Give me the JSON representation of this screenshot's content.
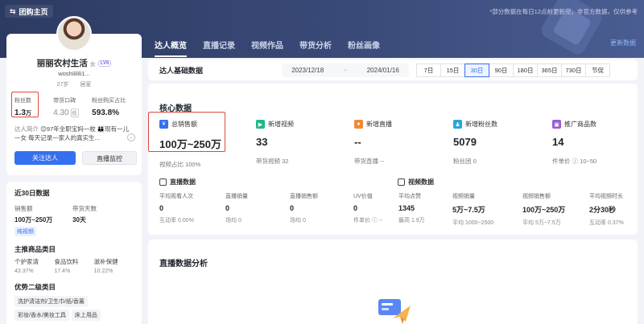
{
  "header": {
    "back_label": "团购主页",
    "note": "*部分数据在每日12点前更新完，非官方数据，仅供参考",
    "tabs": [
      {
        "label": "达人概览",
        "active": true
      },
      {
        "label": "直播记录",
        "active": false
      },
      {
        "label": "视频作品",
        "active": false
      },
      {
        "label": "带货分析",
        "active": false
      },
      {
        "label": "粉丝画像",
        "active": false
      }
    ],
    "right_link": "更新数据"
  },
  "profile": {
    "name": "丽丽农村生活",
    "level_tag": "LV6",
    "gender": "女",
    "handle": "woshililili1...",
    "age": "27岁",
    "location": "居家",
    "stats": [
      {
        "label": "粉丝数",
        "value": "1.3",
        "unit": "万"
      },
      {
        "label": "带货口碑",
        "value": "4.30",
        "badge": "低"
      },
      {
        "label": "粉丝购买占比",
        "value": "593.8%"
      }
    ],
    "bio_label": "达人简介",
    "bio_text": "😊97年全职宝妈一枚 👪现有一儿一女 每天记录一家人的真实生...",
    "follow_button": "关注达人",
    "live_button": "直播监控"
  },
  "left_panel": {
    "title": "近30日数据",
    "labels": [
      "销售额",
      "带货天数"
    ],
    "values": [
      "100万~250万",
      "30天"
    ],
    "chip": "纯视频",
    "category_title": "主推商品类目",
    "categories": [
      "个护家清",
      "食品饮料",
      "滋补保健"
    ],
    "category_pcts": [
      "43.37%",
      "17.4%",
      "10.22%"
    ],
    "secondary_title": "优势二级类目",
    "secondary_tags": [
      "洗护清洁剂/卫生巾/纸/香薰",
      "彩妆/香水/美妆工具",
      "床上用品"
    ]
  },
  "datebar": {
    "title": "达人基础数据",
    "start": "2023/12/18",
    "sep": "~",
    "end": "2024/01/16",
    "ranges": [
      {
        "label": "7日",
        "active": false
      },
      {
        "label": "15日",
        "active": false
      },
      {
        "label": "30日",
        "active": true
      },
      {
        "label": "90日",
        "active": false
      },
      {
        "label": "180日",
        "active": false
      },
      {
        "label": "365日",
        "active": false
      },
      {
        "label": "730日",
        "active": false
      },
      {
        "label": "节促",
        "active": false
      }
    ]
  },
  "core": {
    "title": "核心数据",
    "metrics": [
      {
        "label": "总销售额",
        "value": "100万~250万",
        "sub": "视频占比 100%",
        "color": "#3570f0"
      },
      {
        "label": "新增视频",
        "value": "33",
        "sub": "带货视频 32",
        "color": "#1fb88a"
      },
      {
        "label": "新增直播",
        "value": "--",
        "sub": "带货直播 --",
        "color": "#f08a34"
      },
      {
        "label": "新增粉丝数",
        "value": "5079",
        "sub": "粉丝团 0",
        "color": "#2aa6d8"
      },
      {
        "label": "推广商品数",
        "value": "14",
        "sub": "件单价 ⓘ 10~50",
        "color": "#9b59d6"
      }
    ],
    "live_data_title": "直播数据",
    "video_data_title": "视频数据",
    "live_metrics": [
      {
        "label": "平均观看人次",
        "value": "0",
        "sub": "互动率 0.00%"
      },
      {
        "label": "直播销量",
        "value": "0",
        "sub": "场均 0"
      },
      {
        "label": "直播销售额",
        "value": "0",
        "sub": "场均 0"
      },
      {
        "label": "UV价值",
        "value": "0",
        "sub": "件单价 ⓘ --"
      }
    ],
    "video_metrics": [
      {
        "label": "平均点赞",
        "value": "1345",
        "sub": "最高 1.9万"
      },
      {
        "label": "视频销量",
        "value": "5万~7.5万",
        "sub": "平均 1000~2500"
      },
      {
        "label": "视频销售额",
        "value": "100万~250万",
        "sub": "平均 5万~7.5万"
      },
      {
        "label": "平均视频时长",
        "value": "2分30秒",
        "sub": "互动率 0.37%"
      }
    ]
  },
  "live_panel": {
    "title": "直播数据分析"
  }
}
